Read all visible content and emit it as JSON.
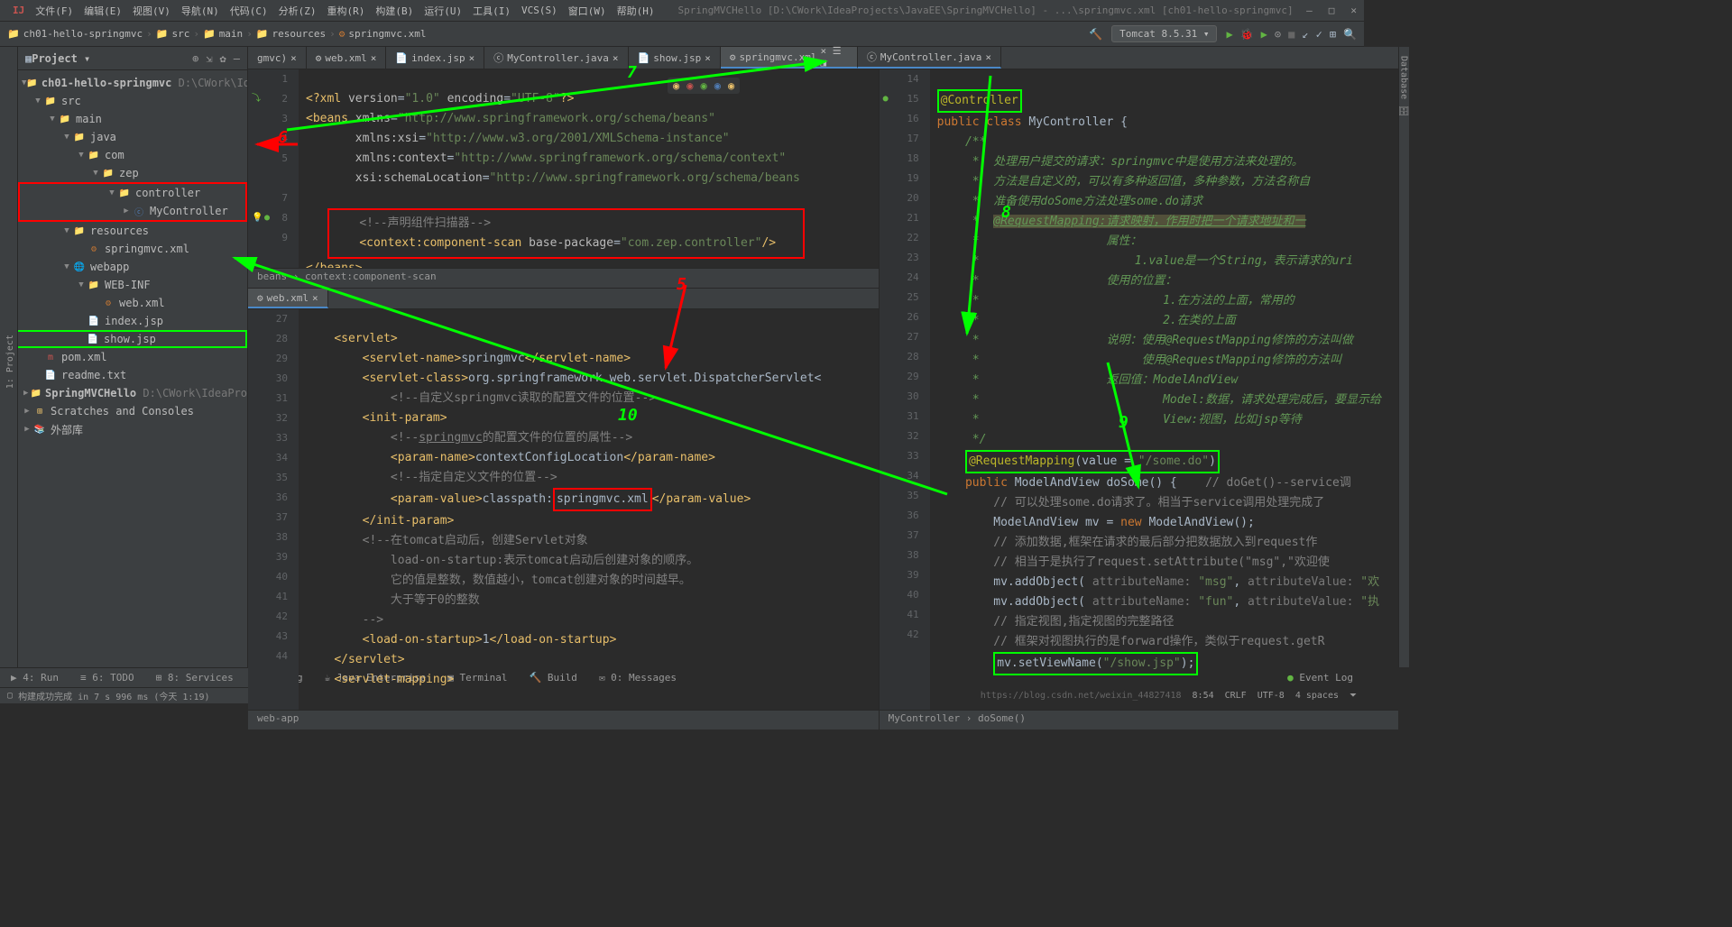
{
  "menubar": {
    "items": [
      "文件(F)",
      "编辑(E)",
      "视图(V)",
      "导航(N)",
      "代码(C)",
      "分析(Z)",
      "重构(R)",
      "构建(B)",
      "运行(U)",
      "工具(I)",
      "VCS(S)",
      "窗口(W)",
      "帮助(H)"
    ],
    "title": "SpringMVCHello [D:\\CWork\\IdeaProjects\\JavaEE\\SpringMVCHello] - ...\\springmvc.xml [ch01-hello-springmvc]"
  },
  "breadcrumb": [
    "ch01-hello-springmvc",
    "src",
    "main",
    "resources",
    "springmvc.xml"
  ],
  "run_config": "Tomcat 8.5.31 ▾",
  "project_panel": {
    "title": "Project ▾"
  },
  "tree": {
    "root": "ch01-hello-springmvc",
    "root_path": "D:\\CWork\\Id",
    "src": "src",
    "main": "main",
    "java": "java",
    "com": "com",
    "zep": "zep",
    "controller": "controller",
    "mycontroller": "MyController",
    "resources": "resources",
    "springmvcxml": "springmvc.xml",
    "webapp": "webapp",
    "webinf": "WEB-INF",
    "webxml": "web.xml",
    "indexjsp": "index.jsp",
    "showjsp": "show.jsp",
    "pomxml": "pom.xml",
    "readme": "readme.txt",
    "springmvchello": "SpringMVCHello",
    "springmvchello_path": "D:\\CWork\\IdeaPro",
    "scratches": "Scratches and Consoles",
    "external": "外部库"
  },
  "tabs_top": {
    "t0": "gmvc)",
    "t1": "web.xml",
    "t2": "index.jsp",
    "t3": "MyController.java",
    "t4": "show.jsp",
    "t5": "springmvc.xml",
    "t6": "MyController.java"
  },
  "webxml_tab": "web.xml",
  "code1": {
    "l1": "<?xml version=\"1.0\" encoding=\"UTF-8\"?>",
    "l2a": "<beans",
    "l2b": " xmlns=\"http://www.springframework.org/schema/beans\"",
    "l3": "       xmlns:xsi=\"http://www.w3.org/2001/XMLSchema-instance\"",
    "l4": "       xmlns:context=\"http://www.springframework.org/schema/context\"",
    "l5": "       xsi:schemaLocation=\"http://www.springframework.org/schema/beans",
    "l7a": "<!--声明组件扫描器-->",
    "l8a": "<context:component-scan",
    "l8b": " base-package=\"com.zep.controller\"/>",
    "l9": "</beans>",
    "breadtrail": "beans  ›  context:component-scan"
  },
  "code2": {
    "l1": "<servlet>",
    "l2": "    <servlet-name>springmvc</servlet-name>",
    "l3a": "    <servlet-class>",
    "l3b": "org.springframework.web.servlet.DispatcherServlet<",
    "l4": "        <!--自定义springmvc读取的配置文件的位置-->",
    "l5": "    <init-param>",
    "l6": "        <!--springmvc的配置文件的位置的属性-->",
    "l7": "        <param-name>contextConfigLocation</param-name>",
    "l8": "        <!--指定自定义文件的位置-->",
    "l9a": "        <param-value>",
    "l9b": "classpath:",
    "l9c": "springmvc.xml",
    "l9d": "</param-value>",
    "l10": "    </init-param>",
    "l11": "    <!--在tomcat启动后，创建Servlet对象",
    "l12": "        load-on-startup:表示tomcat启动后创建对象的顺序。",
    "l13": "        它的值是整数，数值越小，tomcat创建对象的时间越早。",
    "l14": "        大于等于0的整数",
    "l15": "    -->",
    "l16": "    <load-on-startup>1</load-on-startup>",
    "l17": "</servlet>",
    "l18": "<servlet-mapping>",
    "breadtrail": "web-app"
  },
  "code3": {
    "l1": "@Controller",
    "l2a": "public class ",
    "l2b": "MyController {",
    "l3": "/**",
    "l4": " *  处理用户提交的请求：springmvc中是使用方法来处理的。",
    "l5": " *  方法是自定义的，可以有多种返回值，多种参数，方法名称自",
    "l6": " *  准备使用doSome方法处理some.do请求",
    "l7": " *  @RequestMapping:请求映射，作用时把一个请求地址和一",
    "l8": " *                  属性：",
    "l9": " *                      1.value是一个String，表示请求的uri",
    "l10": " *                  使用的位置：",
    "l11": " *                          1.在方法的上面，常用的",
    "l12": " *                          2.在类的上面",
    "l13": " *                  说明：使用@RequestMapping修饰的方法叫做",
    "l14": " *                       使用@RequestMapping修饰的方法叫",
    "l15": " *                  返回值：ModelAndView",
    "l16": " *                          Model:数据，请求处理完成后，要显示给",
    "l17": " *                          View:视图，比如jsp等待",
    "l18": " */",
    "l19a": "@RequestMapping",
    "l19b": "(value = ",
    "l19c": "\"/some.do\"",
    "l19d": ")",
    "l20a": "public ",
    "l20b": "ModelAndView doSome() {    ",
    "l20c": "// doGet()--service调",
    "l21": "// 可以处理some.do请求了。相当于service调用处理完成了",
    "l22a": "ModelAndView mv = ",
    "l22b": "new ",
    "l22c": "ModelAndView();",
    "l23": "// 添加数据,框架在请求的最后部分把数据放入到request作",
    "l24": "// 相当于是执行了request.setAttribute(\"msg\",\"欢迎使",
    "l25a": "mv.addObject( ",
    "l25b": "attributeName: ",
    "l25c": "\"msg\"",
    "l25d": ", ",
    "l25e": "attributeValue: ",
    "l25f": "\"欢",
    "l26a": "mv.addObject( ",
    "l26b": "attributeName: ",
    "l26c": "\"fun\"",
    "l26d": ", ",
    "l26e": "attributeValue: ",
    "l26f": "\"执",
    "l27": "// 指定视图,指定视图的完整路径",
    "l28": "// 框架对视图执行的是forward操作，类似于request.getR",
    "l29a": "mv.setViewName(",
    "l29b": "\"/show.jsp\"",
    "l29c": ");",
    "breadtrail": "MyController  ›  doSome()"
  },
  "bottom_tools": [
    "▶ 4: Run",
    "≡ 6: TODO",
    "⊞ 8: Services",
    "⊙ Spring",
    "☕ Java Enterprise",
    "▣ Terminal",
    "🔨 Build",
    "✉ 0: Messages"
  ],
  "event_log": "Event Log",
  "status": {
    "msg": "构建成功完成 in 7 s 996 ms (今天 1:19)",
    "right": [
      "8:54",
      "CRLF",
      "UTF-8",
      "4 spaces",
      "⏷"
    ],
    "watermark": "https://blog.csdn.net/weixin_44827418"
  },
  "annotations": {
    "n5": "5",
    "n6": "6",
    "n7": "7",
    "n8": "8",
    "n9": "9",
    "n10": "10"
  }
}
